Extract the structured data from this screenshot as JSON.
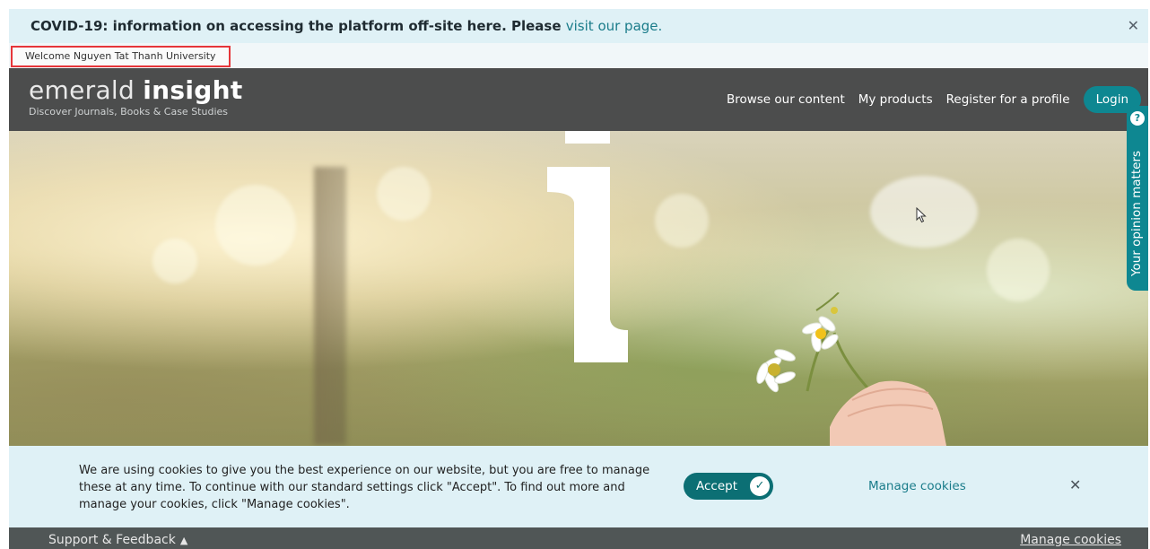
{
  "banner": {
    "text": "COVID-19: information on accessing the platform off-site here. Please",
    "link": "visit our page.",
    "close_icon": "close-icon"
  },
  "welcome": {
    "text": "Welcome Nguyen Tat Thanh University"
  },
  "header": {
    "logo_light": "emerald ",
    "logo_bold": "insight",
    "tagline": "Discover Journals, Books & Case Studies",
    "nav": [
      "Browse our content",
      "My products",
      "Register for a profile"
    ],
    "login": "Login"
  },
  "feedback_tab": {
    "label": "Your opinion matters",
    "icon": "question-icon"
  },
  "cookie": {
    "message": "We are using cookies to give you the best experience on our website, but you are free to manage these at any time. To continue with our standard settings click \"Accept\". To find out more and manage your cookies, click \"Manage cookies\".",
    "accept": "Accept",
    "manage": "Manage cookies",
    "close_icon": "close-icon"
  },
  "footer": {
    "support": "Support & Feedback",
    "manage": "Manage cookies"
  },
  "colors": {
    "accent": "#0e8791",
    "banner_bg": "#dff1f6",
    "header_bg": "#4c4d4d",
    "footer_bg": "#505656",
    "highlight": "#e63539"
  }
}
